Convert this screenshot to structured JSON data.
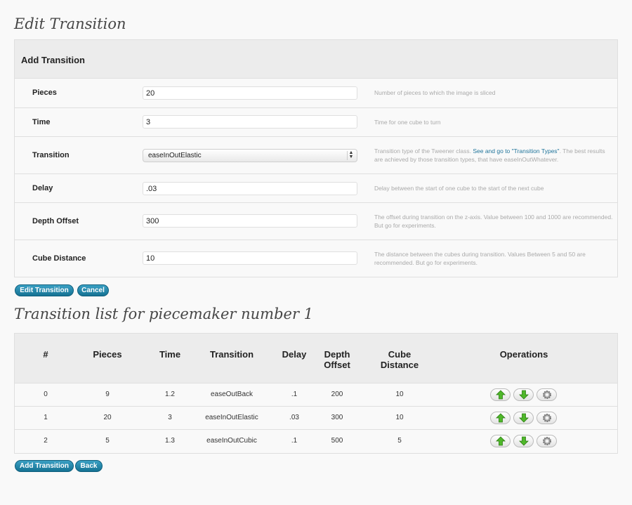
{
  "edit_title": "Edit Transition",
  "form": {
    "header": "Add Transition",
    "fields": [
      {
        "label": "Pieces",
        "value": "20",
        "desc": "Number of pieces to which the image is sliced"
      },
      {
        "label": "Time",
        "value": "3",
        "desc": "Time for one cube to turn"
      },
      {
        "label": "Transition",
        "value": "easeInOutElastic",
        "desc_pre": "Transition type of the Tweener class.",
        "desc_link": "See and go to \"Transition Types\"",
        "desc_post": ". The best results are achieved by those transition types, that have easeInOutWhatever."
      },
      {
        "label": "Delay",
        "value": ".03",
        "desc": "Delay between the start of one cube to the start of the next cube"
      },
      {
        "label": "Depth Offset",
        "value": "300",
        "desc": "The offset during transition on the z-axis. Value between 100 and 1000 are recommended. But go for experiments."
      },
      {
        "label": "Cube Distance",
        "value": "10",
        "desc": "The distance between the cubes during transition. Values Between 5 and 50 are recommended. But go for experiments."
      }
    ],
    "edit_button": "Edit Transition",
    "cancel_button": "Cancel"
  },
  "list_title": "Transition list for piecemaker number 1",
  "list": {
    "headers": {
      "num": "#",
      "pieces": "Pieces",
      "time": "Time",
      "transition": "Transition",
      "delay": "Delay",
      "depth1": "Depth",
      "depth2": "Offset",
      "cube1": "Cube",
      "cube2": "Distance",
      "operations": "Operations"
    },
    "rows": [
      {
        "num": "0",
        "pieces": "9",
        "time": "1.2",
        "transition": "easeOutBack",
        "delay": ".1",
        "depth": "200",
        "cube": "10"
      },
      {
        "num": "1",
        "pieces": "20",
        "time": "3",
        "transition": "easeInOutElastic",
        "delay": ".03",
        "depth": "300",
        "cube": "10"
      },
      {
        "num": "2",
        "pieces": "5",
        "time": "1.3",
        "transition": "easeInOutCubic",
        "delay": ".1",
        "depth": "500",
        "cube": "5"
      }
    ],
    "icons": {
      "up": "arrow-up-icon",
      "down": "arrow-down-icon",
      "settings": "gear-icon"
    },
    "icon_color": "#4fb82a"
  },
  "add_button": "Add Transition",
  "back_button": "Back"
}
